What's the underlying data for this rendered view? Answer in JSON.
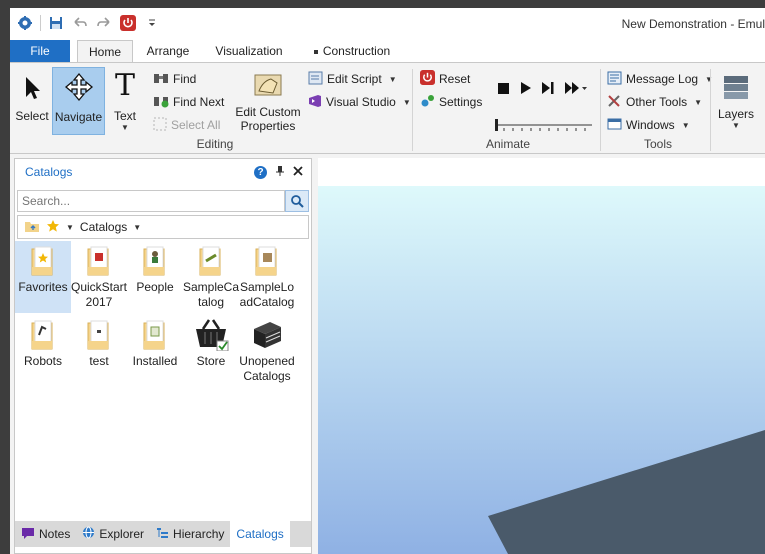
{
  "window": {
    "title": "New Demonstration - Emul"
  },
  "qat": {
    "icons": [
      "app-logo-icon",
      "save-icon",
      "undo-icon",
      "redo-icon",
      "power-icon",
      "customize-icon"
    ]
  },
  "tabs": [
    {
      "label": "File"
    },
    {
      "label": "Home"
    },
    {
      "label": "Arrange"
    },
    {
      "label": "Visualization"
    },
    {
      "label": "Construction"
    }
  ],
  "ribbon": {
    "select": "Select",
    "navigate": "Navigate",
    "text": "Text",
    "find": "Find",
    "find_next": "Find Next",
    "select_all": "Select All",
    "edit_custom_line1": "Edit Custom",
    "edit_custom_line2": "Properties",
    "edit_script": "Edit Script",
    "visual_studio": "Visual Studio",
    "editing_label": "Editing",
    "reset": "Reset",
    "settings": "Settings",
    "animate_label": "Animate",
    "message_log": "Message Log",
    "other_tools": "Other Tools",
    "windows": "Windows",
    "tools_label": "Tools",
    "layers": "Layers"
  },
  "panel": {
    "title": "Catalogs",
    "search_placeholder": "Search...",
    "catalog_dropdown": "Catalogs",
    "items": [
      {
        "line1": "Favorites",
        "line2": ""
      },
      {
        "line1": "QuickStart",
        "line2": "2017"
      },
      {
        "line1": "People",
        "line2": ""
      },
      {
        "line1": "SampleCa",
        "line2": "talog"
      },
      {
        "line1": "SampleLo",
        "line2": "adCatalog"
      },
      {
        "line1": "Robots",
        "line2": ""
      },
      {
        "line1": "test",
        "line2": ""
      },
      {
        "line1": "Installed",
        "line2": ""
      },
      {
        "line1": "Store",
        "line2": ""
      },
      {
        "line1": "Unopened",
        "line2": "Catalogs"
      }
    ],
    "bottom_tabs": [
      "Notes",
      "Explorer",
      "Hierarchy",
      "Catalogs"
    ]
  },
  "colors": {
    "accent": "#1f6fc5",
    "selected": "#a9cdee",
    "viewport_shape": "#4a5a6a"
  }
}
